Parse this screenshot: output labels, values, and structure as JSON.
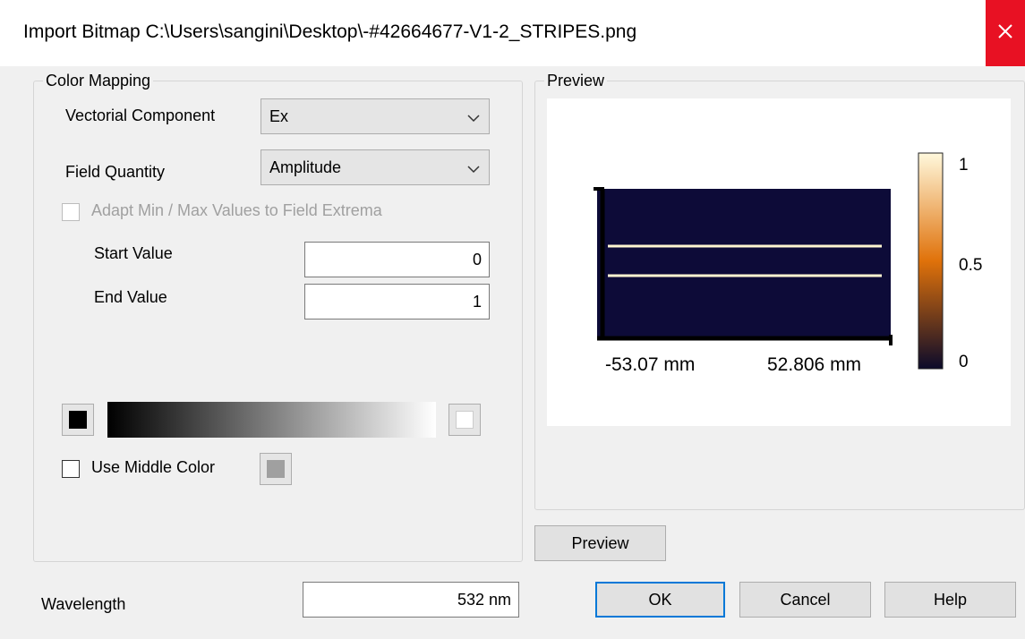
{
  "window": {
    "title": "Import Bitmap C:\\Users\\sangini\\Desktop\\-#42664677-V1-2_STRIPES.png",
    "close_glyph": "✕"
  },
  "color_mapping": {
    "group_title": "Color Mapping",
    "vectorial_component": {
      "label": "Vectorial Component",
      "value": "Ex"
    },
    "field_quantity": {
      "label": "Field Quantity",
      "value": "Amplitude"
    },
    "adapt_checkbox": {
      "label": "Adapt Min / Max Values to Field Extrema",
      "checked": false,
      "enabled": false
    },
    "start_value": {
      "label": "Start Value",
      "value": "0"
    },
    "end_value": {
      "label": "End Value",
      "value": "1"
    },
    "start_color": "#000000",
    "end_color": "#ffffff",
    "use_middle_color": {
      "label": "Use Middle Color",
      "checked": false,
      "color": "#a0a0a0"
    }
  },
  "preview_group": {
    "title": "Preview",
    "image_colors": {
      "background": "#0d0b38",
      "stripe": "#fff6d0"
    },
    "x_axis": {
      "min_label": "-53.07 mm",
      "max_label": "52.806 mm"
    },
    "colorbar": {
      "labels": [
        "1",
        "0.5",
        "0"
      ],
      "colors": [
        "#fff8dc",
        "#e0720a",
        "#0b0a2a"
      ]
    },
    "button_label": "Preview"
  },
  "wavelength": {
    "label": "Wavelength",
    "value": "532 nm"
  },
  "buttons": {
    "ok": "OK",
    "cancel": "Cancel",
    "help": "Help"
  }
}
